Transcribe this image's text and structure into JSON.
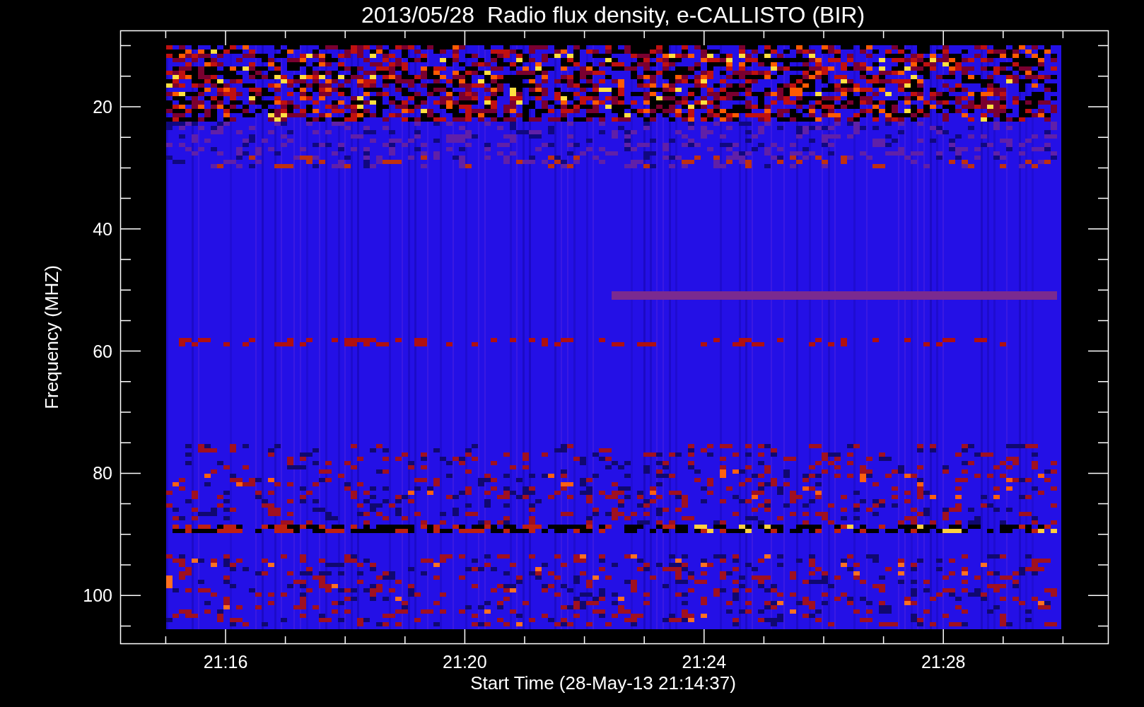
{
  "title": "2013/05/28  Radio flux density, e-CALLISTO (BIR)",
  "y_axis": {
    "label": "Frequency (MHZ)",
    "ticks": [
      "20",
      "40",
      "60",
      "80",
      "100"
    ]
  },
  "x_axis": {
    "label": "Start Time (28-May-13 21:14:37)",
    "ticks": [
      "21:16",
      "21:20",
      "21:24",
      "21:28"
    ]
  }
}
